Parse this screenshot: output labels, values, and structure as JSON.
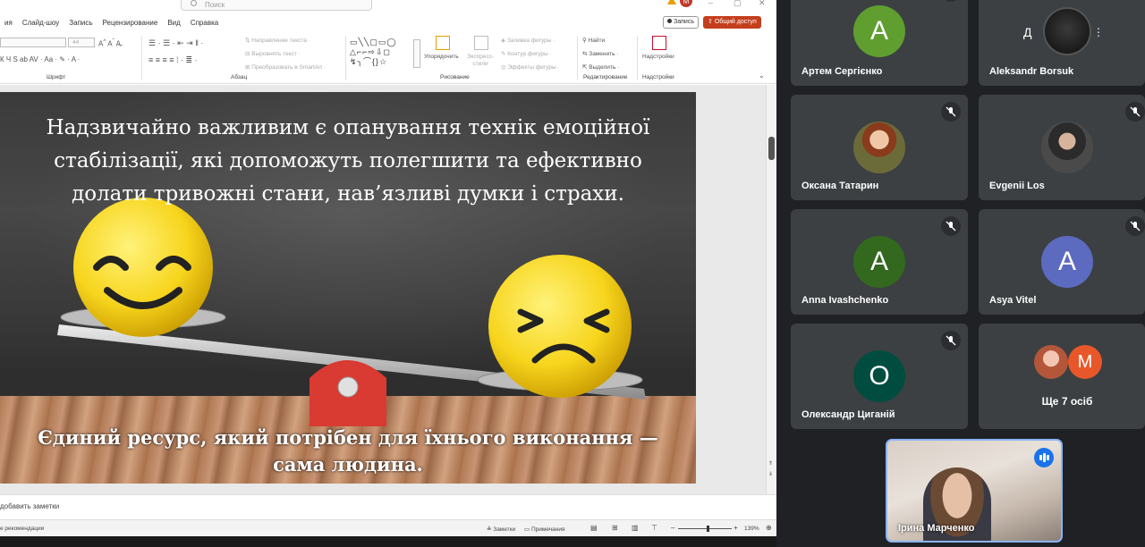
{
  "ppt": {
    "search_placeholder": "Поиск",
    "user_initial": "М",
    "menu": [
      "ия",
      "Слайд-шоу",
      "Запись",
      "Рецензирование",
      "Вид",
      "Справка"
    ],
    "record_label": "Запись",
    "share_label": "Общий доступ",
    "ribbon": {
      "font_size": "44",
      "font_label": "Шрифт",
      "paragraph_label": "Абзац",
      "text_direction": "Направление текста",
      "align_text": "Выровнять текст",
      "smartart": "Преобразовать в SmartArt",
      "arrange": "Упорядочить",
      "quick_styles": "Экспресс-стили",
      "shape_fill": "Заливка фигуры",
      "shape_outline": "Контур фигуры",
      "shape_effects": "Эффекты фигуры",
      "drawing_label": "Рисование",
      "find": "Найти",
      "replace": "Заменить",
      "select": "Выделить",
      "editing_label": "Редактирование",
      "addins": "Надстройки",
      "addins_label": "Надстройки"
    },
    "slide": {
      "top_text": "Надзвичайно важливим є опанування технік емоційної стабілізації, які допоможуть полегшити та ефективно долати тривожні стани, нав’язливі думки і страхи.",
      "bottom_text": "Єдиний ресурс, який потрібен для їхнього виконання — сама людина."
    },
    "notes_placeholder": "добавить заметки",
    "status": {
      "left": "е рекомендации",
      "notes": "Заметки",
      "comments": "Примечания",
      "zoom": "139%"
    }
  },
  "meet": {
    "participants": [
      {
        "name": "Артем Сергієнко",
        "initial": "А",
        "color": "#5f9e2f",
        "muted": true
      },
      {
        "name": "Aleksandr Borsuk",
        "muted": false
      },
      {
        "name": "Оксана Татарин",
        "muted": true
      },
      {
        "name": "Evgenii Los",
        "muted": true
      },
      {
        "name": "Anna Ivashchenko",
        "initial": "A",
        "color": "#33691e",
        "muted": true
      },
      {
        "name": "Asya Vitel",
        "initial": "A",
        "color": "#5c6bc0",
        "muted": true
      },
      {
        "name": "Олександр Циганій",
        "initial": "О",
        "color": "#004d40",
        "muted": true
      }
    ],
    "more": {
      "label": "Ще 7 осіб",
      "initial": "M",
      "color": "#e8572a"
    },
    "self": {
      "name": "Ірина Марченко"
    },
    "pin_label": "Д"
  }
}
